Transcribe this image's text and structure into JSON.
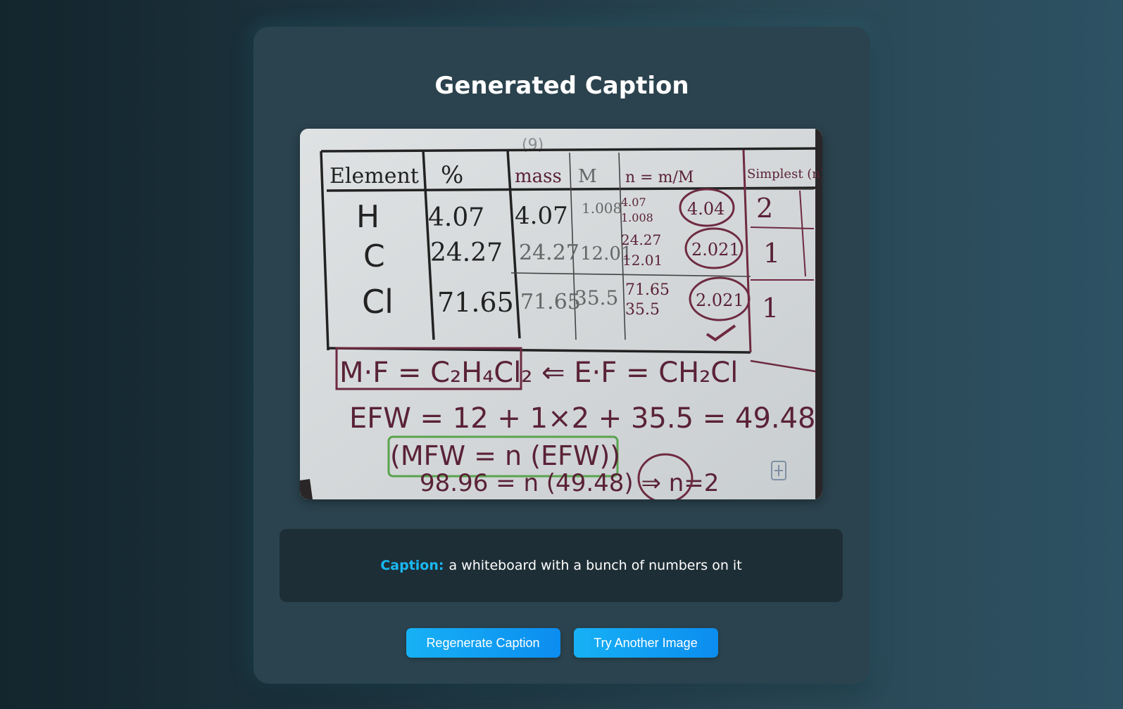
{
  "page": {
    "title": "Generated Caption"
  },
  "image": {
    "table_headers": [
      "Element",
      "%",
      "mass",
      "M",
      "n = m/M",
      "Simplest (n)"
    ],
    "rows": [
      {
        "element": "H",
        "percent": "4.07",
        "mass": "4.07",
        "M": "1.008",
        "calc_num": "4.07",
        "calc_den": "1.008",
        "n": "4.04",
        "simple": "2"
      },
      {
        "element": "C",
        "percent": "24.27",
        "mass": "24.27",
        "M": "12.01",
        "calc_num": "24.27",
        "calc_den": "12.01",
        "n": "2.021",
        "simple": "1"
      },
      {
        "element": "Cl",
        "percent": "71.65",
        "mass": "71.65",
        "M": "35.5",
        "calc_num": "71.65",
        "calc_den": "35.5",
        "n": "2.021",
        "simple": "1"
      }
    ],
    "line1": "M·F = C₂H₄Cl₂ ⇐ E·F = CH₂Cl",
    "line2": "EFW = 12 + 1×2 + 35.5 = 49.48",
    "line3": "(MFW = n (EFW))",
    "line4": "98.96 = n (49.48) ⇒ n=2",
    "page_marker": "(9)"
  },
  "caption": {
    "label": "Caption:",
    "text": "a whiteboard with a bunch of numbers on it"
  },
  "buttons": {
    "regenerate": "Regenerate Caption",
    "try_another": "Try Another Image"
  },
  "colors": {
    "accent": "#19b8f2",
    "button": "#0b8df0",
    "card": "#2b434e",
    "caption_box": "#1e2e36"
  }
}
